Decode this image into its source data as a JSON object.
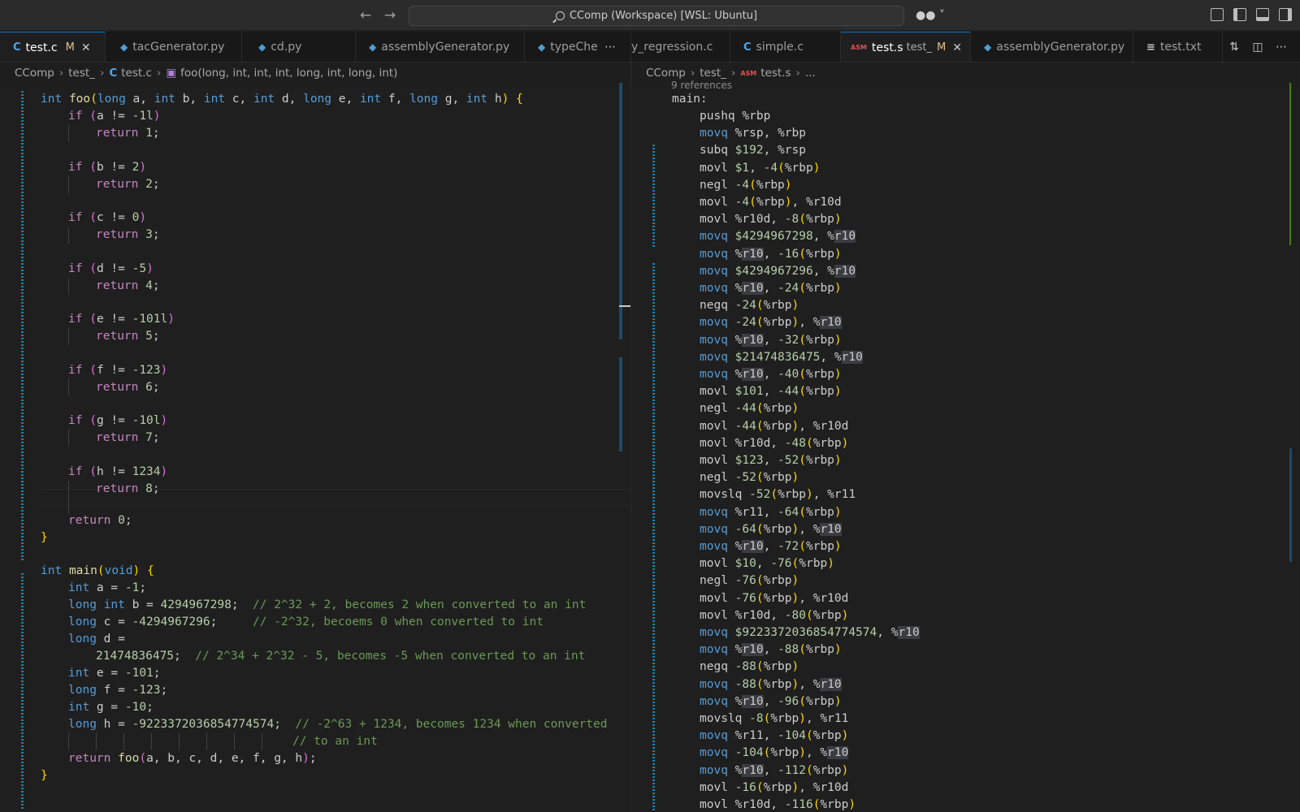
{
  "titlebar": {
    "search_text": "CComp (Workspace) [WSL: Ubuntu]",
    "back_icon": "arrow-left-icon",
    "forward_icon": "arrow-right-icon",
    "copilot_icon": "copilot-icon"
  },
  "left_tabs": [
    {
      "label": "test.c",
      "icon": "c-file-icon",
      "modified": "M",
      "active": true
    },
    {
      "label": "tacGenerator.py",
      "icon": "python-file-icon"
    },
    {
      "label": "cd.py",
      "icon": "python-file-icon"
    },
    {
      "label": "assemblyGenerator.py",
      "icon": "python-file-icon"
    },
    {
      "label": "typeChe",
      "icon": "python-file-icon"
    }
  ],
  "right_tabs": [
    {
      "label": "y_regression.c"
    },
    {
      "label": "simple.c",
      "icon": "c-file-icon"
    },
    {
      "label": "test.s",
      "desc": "test_",
      "icon": "asm-file-icon",
      "modified": "M",
      "active": true
    },
    {
      "label": "assemblyGenerator.py",
      "icon": "python-file-icon"
    },
    {
      "label": "test.txt",
      "icon": "text-file-icon"
    }
  ],
  "left_breadcrumb": {
    "root": "CComp",
    "folder": "test_",
    "file": "test.c",
    "symbol": "foo(long, int, int, int, long, int, long, int)"
  },
  "right_breadcrumb": {
    "root": "CComp",
    "folder": "test_",
    "file": "test.s",
    "more": "..."
  },
  "left_code": {
    "foo_sig": {
      "kw_int": "int",
      "name": "foo",
      "p1": "long",
      "a": " a, ",
      "p2": "int",
      "b": " b, ",
      "p3": "int",
      "c": " c, ",
      "p4": "int",
      "d": " d, ",
      "p5": "long",
      "e": " e, ",
      "p6": "int",
      "f": " f, ",
      "p7": "long",
      "g": " g, ",
      "p8": "int",
      "h": " h",
      "open": "(",
      "close": ")",
      "brace": " {"
    },
    "checks": [
      {
        "cond": "a != ",
        "val": "-1l",
        "ret": "1"
      },
      {
        "cond": "b != ",
        "val": "2",
        "ret": "2"
      },
      {
        "cond": "c != ",
        "val": "0",
        "ret": "3"
      },
      {
        "cond": "d != ",
        "val": "-5",
        "ret": "4"
      },
      {
        "cond": "e != ",
        "val": "-101l",
        "ret": "5"
      },
      {
        "cond": "f != ",
        "val": "-123",
        "ret": "6"
      },
      {
        "cond": "g != ",
        "val": "-10l",
        "ret": "7"
      },
      {
        "cond": "h != ",
        "val": "1234",
        "ret": "8"
      }
    ],
    "kw_if": "if",
    "kw_return": "return",
    "return_zero": "0",
    "close_brace": "}",
    "main_sig": {
      "kw_int": "int",
      "name": "main",
      "void": "void"
    },
    "decl_a": {
      "type": "int",
      "rest": " a = ",
      "val": "-1",
      "end": ";"
    },
    "decl_b": {
      "type": "long int",
      "rest": " b = ",
      "val": "4294967298",
      "end": ";",
      "comment": "// 2^32 + 2, becomes 2 when converted to an int"
    },
    "decl_c": {
      "type": "long",
      "rest": " c = ",
      "val": "-4294967296",
      "end": ";",
      "comment": "// -2^32, becoems 0 when converted to int"
    },
    "decl_d": {
      "type": "long",
      "rest": " d ="
    },
    "decl_d2": {
      "val": "21474836475",
      "end": ";",
      "comment": "// 2^34 + 2^32 - 5, becomes -5 when converted to an int"
    },
    "decl_e": {
      "type": "int",
      "rest": " e = ",
      "val": "-101",
      "end": ";"
    },
    "decl_f": {
      "type": "long",
      "rest": " f = ",
      "val": "-123",
      "end": ";"
    },
    "decl_g": {
      "type": "int",
      "rest": " g = ",
      "val": "-10",
      "end": ";"
    },
    "decl_h": {
      "type": "long",
      "rest": " h = ",
      "val": "-9223372036854774574",
      "end": ";",
      "comment": "// -2^63 + 1234, becomes 1234 when converted"
    },
    "decl_h2": {
      "comment": "// to an int"
    },
    "final_return": {
      "args": "a, b, c, d, e, f, g, h",
      "end": ";"
    }
  },
  "right_code": {
    "references": "9 references",
    "label": "main:",
    "lines": [
      [
        "pushq",
        " %rbp"
      ],
      [
        "movq",
        " %rsp, %rbp"
      ],
      [
        "subq",
        " $192, %rsp"
      ],
      [
        "movl",
        " $1, -4(%rbp)"
      ],
      [
        "negl",
        " -4(%rbp)"
      ],
      [
        "movl",
        " -4(%rbp), %r10d"
      ],
      [
        "movl",
        " %r10d, -8(%rbp)"
      ],
      [
        "movq",
        " $4294967298, %r10"
      ],
      [
        "movq",
        " %r10, -16(%rbp)"
      ],
      [
        "movq",
        " $4294967296, %r10"
      ],
      [
        "movq",
        " %r10, -24(%rbp)"
      ],
      [
        "negq",
        " -24(%rbp)"
      ],
      [
        "movq",
        " -24(%rbp), %r10"
      ],
      [
        "movq",
        " %r10, -32(%rbp)"
      ],
      [
        "movq",
        " $21474836475, %r10"
      ],
      [
        "movq",
        " %r10, -40(%rbp)"
      ],
      [
        "movl",
        " $101, -44(%rbp)"
      ],
      [
        "negl",
        " -44(%rbp)"
      ],
      [
        "movl",
        " -44(%rbp), %r10d"
      ],
      [
        "movl",
        " %r10d, -48(%rbp)"
      ],
      [
        "movl",
        " $123, -52(%rbp)"
      ],
      [
        "negl",
        " -52(%rbp)"
      ],
      [
        "movslq",
        " -52(%rbp), %r11"
      ],
      [
        "movq",
        " %r11, -64(%rbp)"
      ],
      [
        "movq",
        " -64(%rbp), %r10"
      ],
      [
        "movq",
        " %r10, -72(%rbp)"
      ],
      [
        "movl",
        " $10, -76(%rbp)"
      ],
      [
        "negl",
        " -76(%rbp)"
      ],
      [
        "movl",
        " -76(%rbp), %r10d"
      ],
      [
        "movl",
        " %r10d, -80(%rbp)"
      ],
      [
        "movq",
        " $9223372036854774574, %r10"
      ],
      [
        "movq",
        " %r10, -88(%rbp)"
      ],
      [
        "negq",
        " -88(%rbp)"
      ],
      [
        "movq",
        " -88(%rbp), %r10"
      ],
      [
        "movq",
        " %r10, -96(%rbp)"
      ],
      [
        "movslq",
        " -8(%rbp), %r11"
      ],
      [
        "movq",
        " %r11, -104(%rbp)"
      ],
      [
        "movq",
        " -104(%rbp), %r10"
      ],
      [
        "movq",
        " %r10, -112(%rbp)"
      ],
      [
        "movl",
        " -16(%rbp), %r10d"
      ],
      [
        "movl",
        " %r10d, -116(%rbp)"
      ]
    ]
  },
  "colors": {
    "accent": "#0078d4",
    "keyword": "#569cd6",
    "control": "#c586c0",
    "function": "#dcdcaa",
    "number": "#b5cea8",
    "comment": "#6a9955",
    "modified": "#e2c08d"
  }
}
